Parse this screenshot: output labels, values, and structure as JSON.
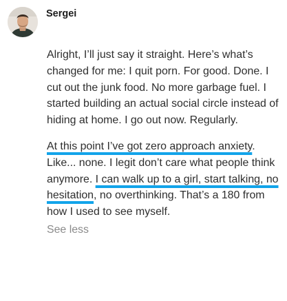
{
  "comment": {
    "author": "Sergei",
    "avatar_icon": "user-avatar-photo",
    "paragraphs": [
      {
        "segments": [
          {
            "text": "Alright, I’ll just say it straight. Here’s what’s changed for me: I quit porn. For good. Done. I cut out the junk food. No more garbage fuel. I started building an actual social circle instead of hiding at home. I go out now. Regularly.",
            "highlight": false
          }
        ]
      },
      {
        "segments": [
          {
            "text": "At this point I’ve got zero approach anxiety",
            "highlight": true
          },
          {
            "text": ". Like... none. I legit don’t care what people think anymore. ",
            "highlight": false
          },
          {
            "text": "I can walk up to a girl, start talking, no hesitation",
            "highlight": true
          },
          {
            "text": ", no overthinking. That’s a 180 from how I used to see myself.",
            "highlight": false
          }
        ]
      }
    ],
    "see_less_label": "See less",
    "highlight_color": "#12a4ea"
  }
}
